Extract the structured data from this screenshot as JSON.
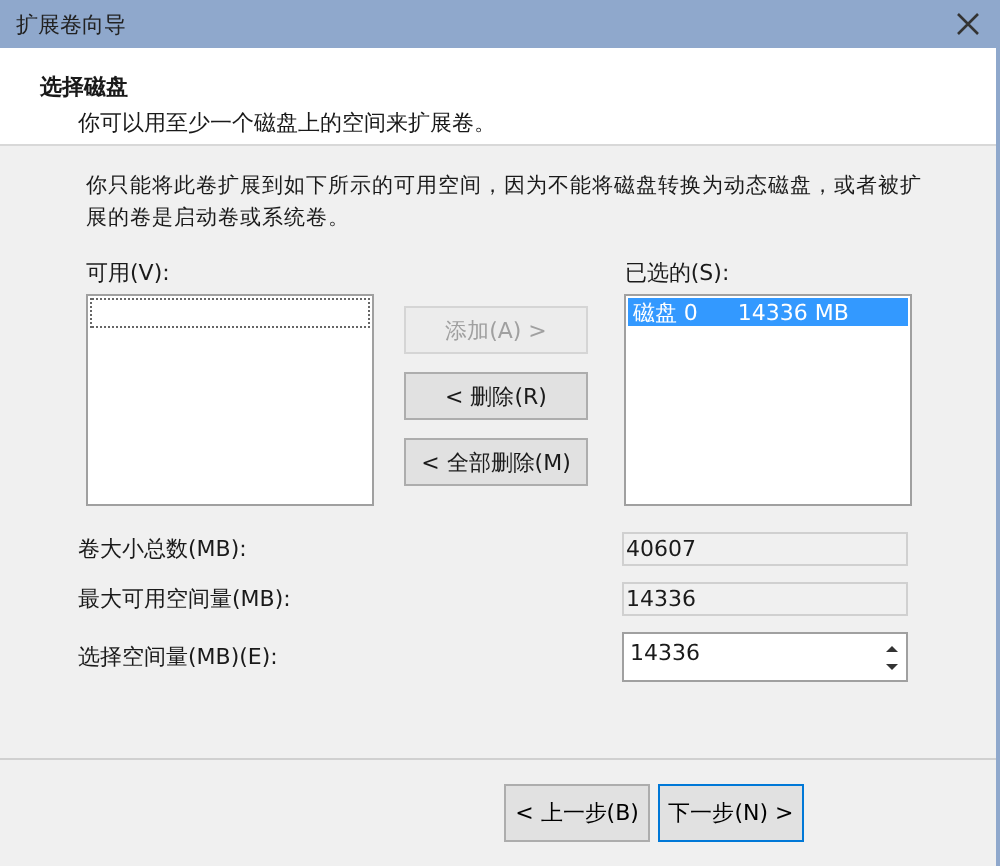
{
  "window": {
    "title": "扩展卷向导"
  },
  "header": {
    "title": "选择磁盘",
    "subtitle": "你可以用至少一个磁盘上的空间来扩展卷。"
  },
  "note": "你只能将此卷扩展到如下所示的可用空间，因为不能将磁盘转换为动态磁盘，或者被扩展的卷是启动卷或系统卷。",
  "available": {
    "label": "可用(V):"
  },
  "selected_list": {
    "label": "已选的(S):",
    "items": [
      {
        "disk": "磁盘 0",
        "size": "14336 MB",
        "selected": true
      }
    ]
  },
  "move_buttons": [
    {
      "label": "添加(A) >",
      "disabled": true
    },
    {
      "label": "< 删除(R)",
      "disabled": false
    },
    {
      "label": "< 全部删除(M)",
      "disabled": false
    }
  ],
  "fields": [
    {
      "label": "卷大小总数(MB):",
      "value": "40607",
      "kind": "readonly"
    },
    {
      "label": "最大可用空间量(MB):",
      "value": "14336",
      "kind": "readonly"
    },
    {
      "label": "选择空间量(MB)(E):",
      "value": "14336",
      "kind": "spinner"
    }
  ],
  "footer_buttons": [
    {
      "label": "< 上一步(B)",
      "default": false
    },
    {
      "label": "下一步(N) >",
      "default": true
    }
  ]
}
